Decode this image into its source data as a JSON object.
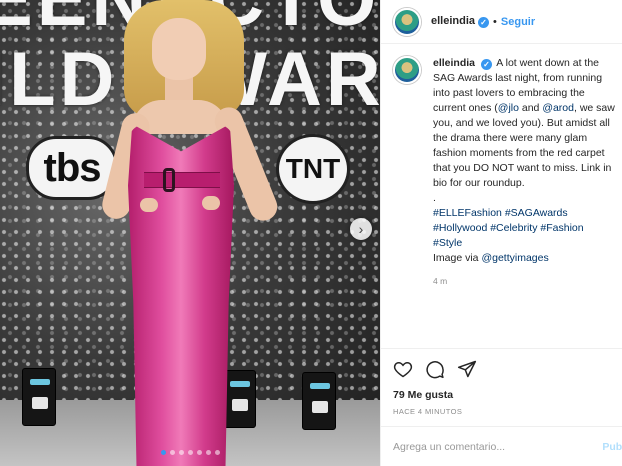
{
  "photo": {
    "backdrop_text_line1": "EENACTO",
    "backdrop_text_line2": "ILD AWAR",
    "logo_left": "tbs",
    "logo_right": "TNT",
    "carousel_dots": 7,
    "carousel_active": 0
  },
  "post": {
    "username": "elleindia",
    "follow_label": "Seguir",
    "separator": "•",
    "caption_parts": [
      {
        "text": "A lot went down at the SAG Awards last night, from running into past lovers to embracing the current ones (",
        "link": false
      },
      {
        "text": "@jlo",
        "link": true
      },
      {
        "text": " and ",
        "link": false
      },
      {
        "text": "@arod",
        "link": true
      },
      {
        "text": ", we saw you, and we loved you). But amidst all the drama there were many glam fashion moments from the red carpet that you DO NOT want to miss. Link in bio for our roundup.",
        "link": false
      }
    ],
    "caption_dot": ".",
    "hashtags_line1": [
      "#ELLEFashion",
      "#SAGAwards"
    ],
    "hashtags_line2": [
      "#Hollywood",
      "#Celebrity",
      "#Fashion"
    ],
    "hashtags_line3": [
      "#Style"
    ],
    "credit_prefix": "Image via ",
    "credit_handle": "@gettyimages",
    "caption_age": "4 m",
    "likes": "79 Me gusta",
    "timestamp": "HACE 4 MINUTOS",
    "comment_placeholder": "Agrega un comentario...",
    "publish_label": "Publi"
  },
  "colors": {
    "accent": "#3897f0",
    "link": "#003569",
    "dress": "#e04e9e"
  }
}
